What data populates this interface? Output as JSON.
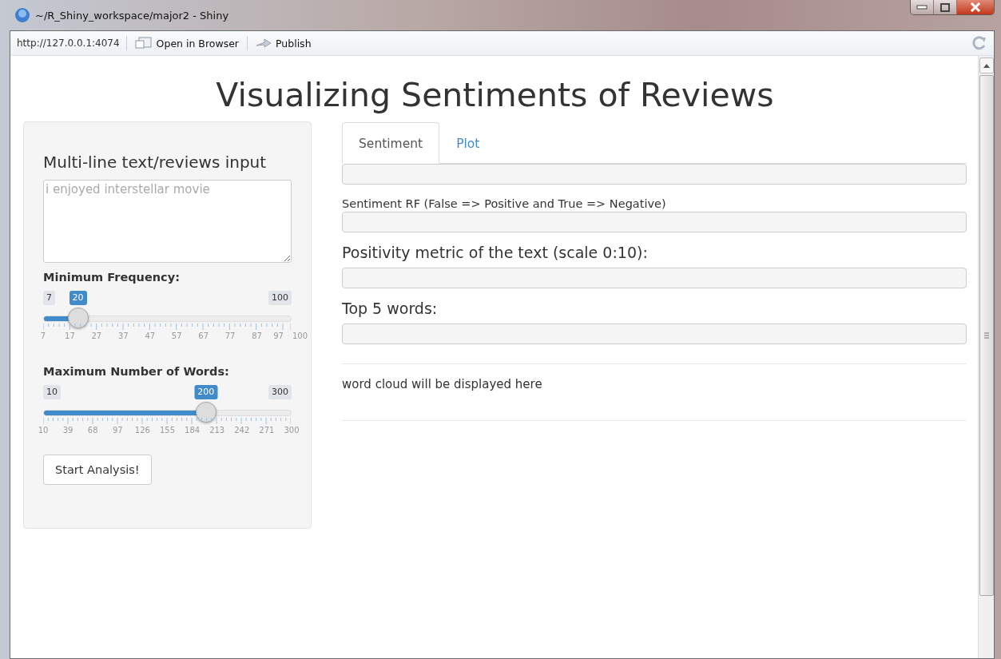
{
  "window": {
    "title": "~/R_Shiny_workspace/major2 - Shiny"
  },
  "toolbar": {
    "url": "http://127.0.0.1:4074",
    "open_button": "Open in Browser",
    "publish_button": "Publish"
  },
  "page": {
    "title": "Visualizing Sentiments of Reviews"
  },
  "sidebar": {
    "text_input": {
      "label": "Multi-line text/reviews input",
      "placeholder": "i enjoyed interstellar movie"
    },
    "sliders": [
      {
        "label": "Minimum Frequency:",
        "min": "7",
        "max": "100",
        "value": "20",
        "level": 0.14,
        "ticks": [
          "7",
          "17",
          "27",
          "37",
          "47",
          "57",
          "67",
          "77",
          "87",
          "97",
          "100"
        ]
      },
      {
        "label": "Maximum Number of Words:",
        "min": "10",
        "max": "300",
        "value": "200",
        "level": 0.655,
        "ticks": [
          "10",
          "39",
          "68",
          "97",
          "126",
          "155",
          "184",
          "213",
          "242",
          "271",
          "300"
        ]
      }
    ],
    "button": "Start Analysis!"
  },
  "tabs": [
    {
      "label": "Sentiment",
      "selected": true
    },
    {
      "label": "Plot",
      "selected": false
    }
  ],
  "outputs": [
    {
      "kind": "box"
    },
    {
      "kind": "label",
      "text": "Sentiment RF (False => Positive and True => Negative)"
    },
    {
      "kind": "box"
    },
    {
      "kind": "heading",
      "text": "Positivity metric of the text (scale 0:10):"
    },
    {
      "kind": "box"
    },
    {
      "kind": "heading",
      "text": "Top 5 words:"
    },
    {
      "kind": "box"
    },
    {
      "kind": "rule"
    },
    {
      "kind": "text",
      "text": "word cloud will be displayed here"
    },
    {
      "kind": "rule"
    }
  ]
}
